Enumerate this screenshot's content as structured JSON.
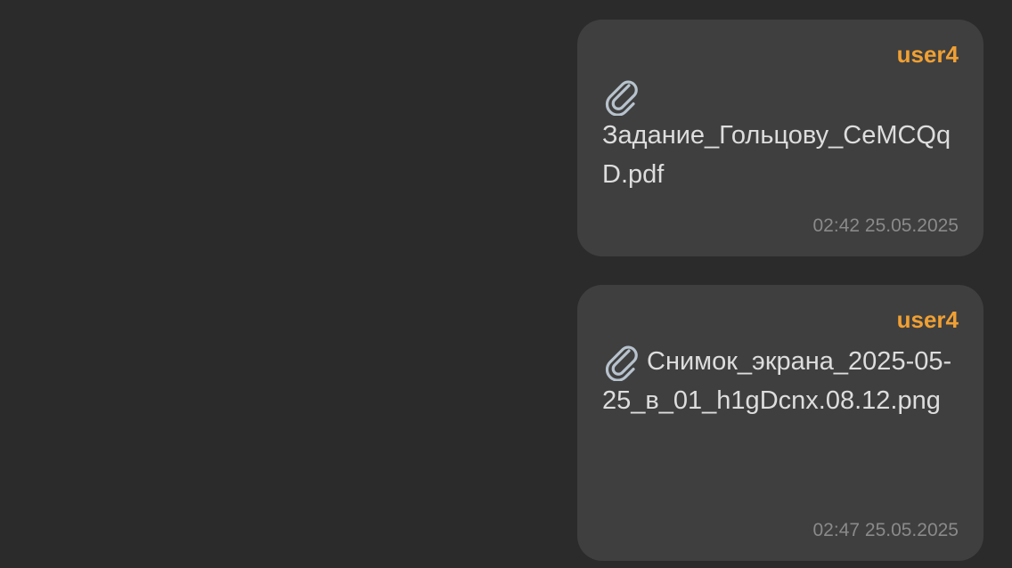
{
  "messages": [
    {
      "sender": "user4",
      "icon": "paperclip-icon",
      "attachment_name": "Задание_Гольцову_CeMCQqD.pdf",
      "timestamp": "02:42 25.05.2025"
    },
    {
      "sender": "user4",
      "icon": "paperclip-icon",
      "attachment_name": "Снимок_экрана_2025-05-25_в_01_h1gDcnx.08.12.png",
      "timestamp": "02:47 25.05.2025"
    }
  ],
  "colors": {
    "background": "#2b2b2b",
    "bubble": "#3f3f3f",
    "sender": "#f0a033",
    "text": "#dddddd",
    "timestamp": "#8a8a8a"
  }
}
